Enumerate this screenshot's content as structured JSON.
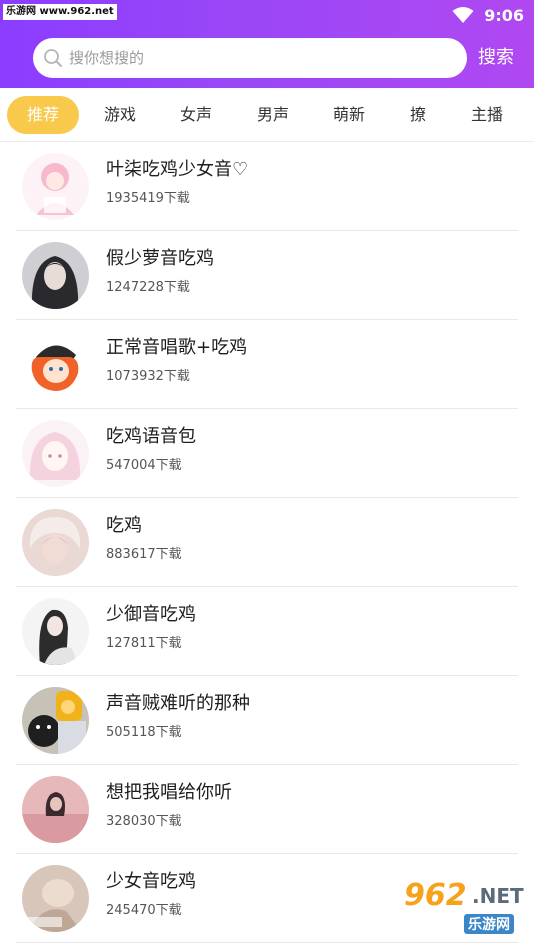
{
  "statusbar": {
    "watermark": "乐游网 www.962.net",
    "time": "9:06"
  },
  "search": {
    "placeholder": "搜你想搜的",
    "button_label": "搜索"
  },
  "tabs": [
    {
      "label": "推荐",
      "active": true
    },
    {
      "label": "游戏"
    },
    {
      "label": "女声"
    },
    {
      "label": "男声"
    },
    {
      "label": "萌新"
    },
    {
      "label": "撩"
    },
    {
      "label": "主播"
    }
  ],
  "voice_packs": [
    {
      "title": "叶柒吃鸡少女音♡",
      "downloads": "1935419下载"
    },
    {
      "title": "假少萝音吃鸡",
      "downloads": "1247228下载"
    },
    {
      "title": "正常音唱歌+吃鸡",
      "downloads": "1073932下载"
    },
    {
      "title": "吃鸡语音包",
      "downloads": "547004下载"
    },
    {
      "title": "吃鸡",
      "downloads": "883617下载"
    },
    {
      "title": "少御音吃鸡",
      "downloads": "127811下载"
    },
    {
      "title": "声音贼难听的那种",
      "downloads": "505118下载"
    },
    {
      "title": "想把我唱给你听",
      "downloads": "328030下载"
    },
    {
      "title": "少女音吃鸡",
      "downloads": "245470下载"
    }
  ],
  "watermark_logo": {
    "number": "962",
    "net": ".NET",
    "cn": "乐游网"
  },
  "colors": {
    "header_start": "#8b3dff",
    "header_end": "#b048f2",
    "tab_active": "#f8c94a"
  }
}
